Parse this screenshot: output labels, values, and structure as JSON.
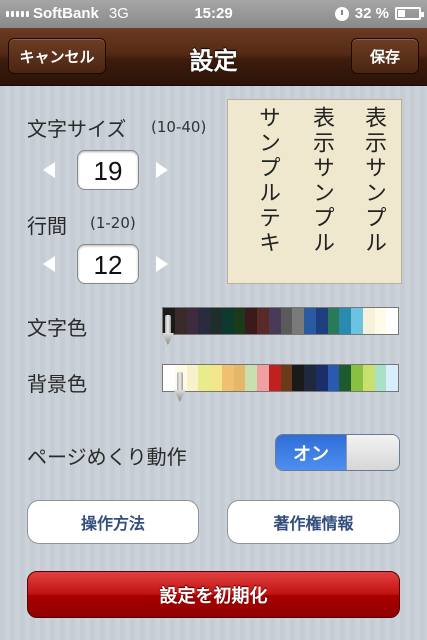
{
  "status": {
    "carrier": "SoftBank",
    "network": "3G",
    "time": "15:29",
    "battery_pct": "32 %",
    "battery_level": 0.32
  },
  "nav": {
    "title": "設定",
    "cancel_label": "キャンセル",
    "save_label": "保存"
  },
  "font_size": {
    "label": "文字サイズ",
    "range": "(10-40)",
    "value": "19"
  },
  "line_spacing": {
    "label": "行間",
    "range": "(1-20)",
    "value": "12"
  },
  "preview": {
    "lines": [
      "表示サンプル",
      "表示サンプル",
      "サンプルテキ"
    ]
  },
  "text_color": {
    "label": "文字色",
    "swatches": [
      "#1a1a1a",
      "#3a2a2a",
      "#3e2c3e",
      "#2a2a40",
      "#1e2e2a",
      "#0e3a2e",
      "#1a3a1a",
      "#3a1a1a",
      "#5a2a2a",
      "#4a3a5a",
      "#5a5a5a",
      "#7a7a7a",
      "#2a5aa0",
      "#1e3e7e",
      "#2a7a5a",
      "#2a8ab0",
      "#6ac4e0",
      "#f5f2dc",
      "#fffbe8",
      "#ffffff"
    ],
    "selected_index": 0
  },
  "bg_color": {
    "label": "背景色",
    "swatches": [
      "#ffffff",
      "#fdfbe6",
      "#f8f2cc",
      "#e8ec8c",
      "#f2e68a",
      "#f0c070",
      "#e3b86a",
      "#c8e0b0",
      "#f0a0a0",
      "#c02020",
      "#6a3a1a",
      "#1a1a1a",
      "#202840",
      "#1a2e6a",
      "#2a5ab0",
      "#1e5a30",
      "#8ac040",
      "#c8e070",
      "#a8e0c8",
      "#d8eeff"
    ],
    "selected_index": 1
  },
  "page_turn": {
    "label": "ページめくり動作",
    "switch_label": "オン",
    "enabled": true
  },
  "buttons": {
    "operation": "操作方法",
    "copyright": "著作権情報",
    "reset": "設定を初期化"
  }
}
